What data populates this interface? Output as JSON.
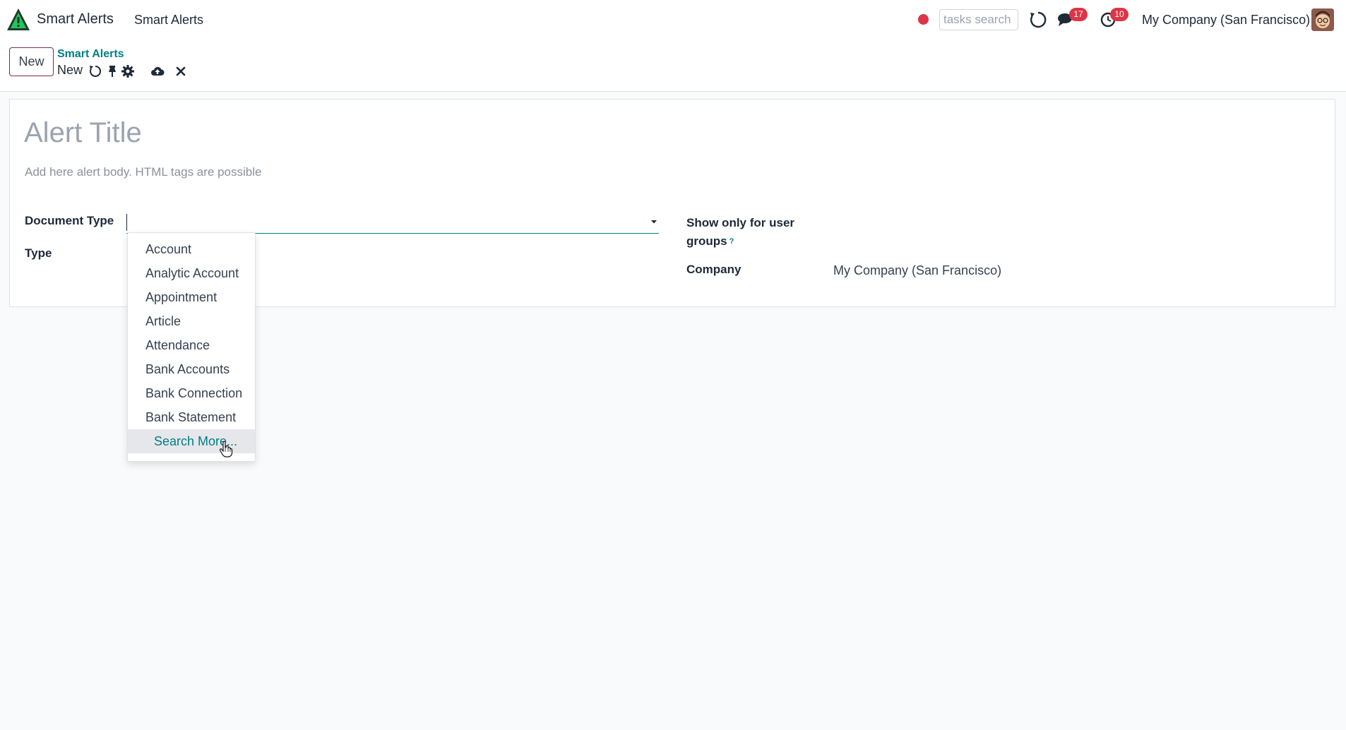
{
  "navbar": {
    "app_name": "Smart Alerts",
    "menu_item": "Smart Alerts",
    "tasks_search_placeholder": "tasks search",
    "messages_badge": "17",
    "activities_badge": "10",
    "company_switch": "My Company (San Francisco)",
    "logo_icon": "odoo-triangle-logo",
    "status_color": "#dc3545"
  },
  "control_panel": {
    "new_button": "New",
    "breadcrumb_parent": "Smart Alerts",
    "record_name": "New",
    "icons": [
      "refresh-icon",
      "pin-icon",
      "gear-icon",
      "cloud-upload-icon",
      "close-icon"
    ]
  },
  "form": {
    "title_placeholder": "Alert Title",
    "body_placeholder": "Add here alert body. HTML tags are possible",
    "document_type_label": "Document Type",
    "document_type_value": "",
    "type_label": "Type",
    "groups_label_line1": "Show only for user",
    "groups_label_line2": "groups",
    "groups_tooltip": "?",
    "company_label": "Company",
    "company_value": "My Company (San Francisco)"
  },
  "dropdown": {
    "items": [
      "Account",
      "Analytic Account",
      "Appointment",
      "Article",
      "Attendance",
      "Bank Accounts",
      "Bank Connection",
      "Bank Statement"
    ],
    "search_more": "Search More..."
  },
  "colors": {
    "accent": "#017e84",
    "brand": "#7c2b4d",
    "badge": "#dc3545"
  }
}
